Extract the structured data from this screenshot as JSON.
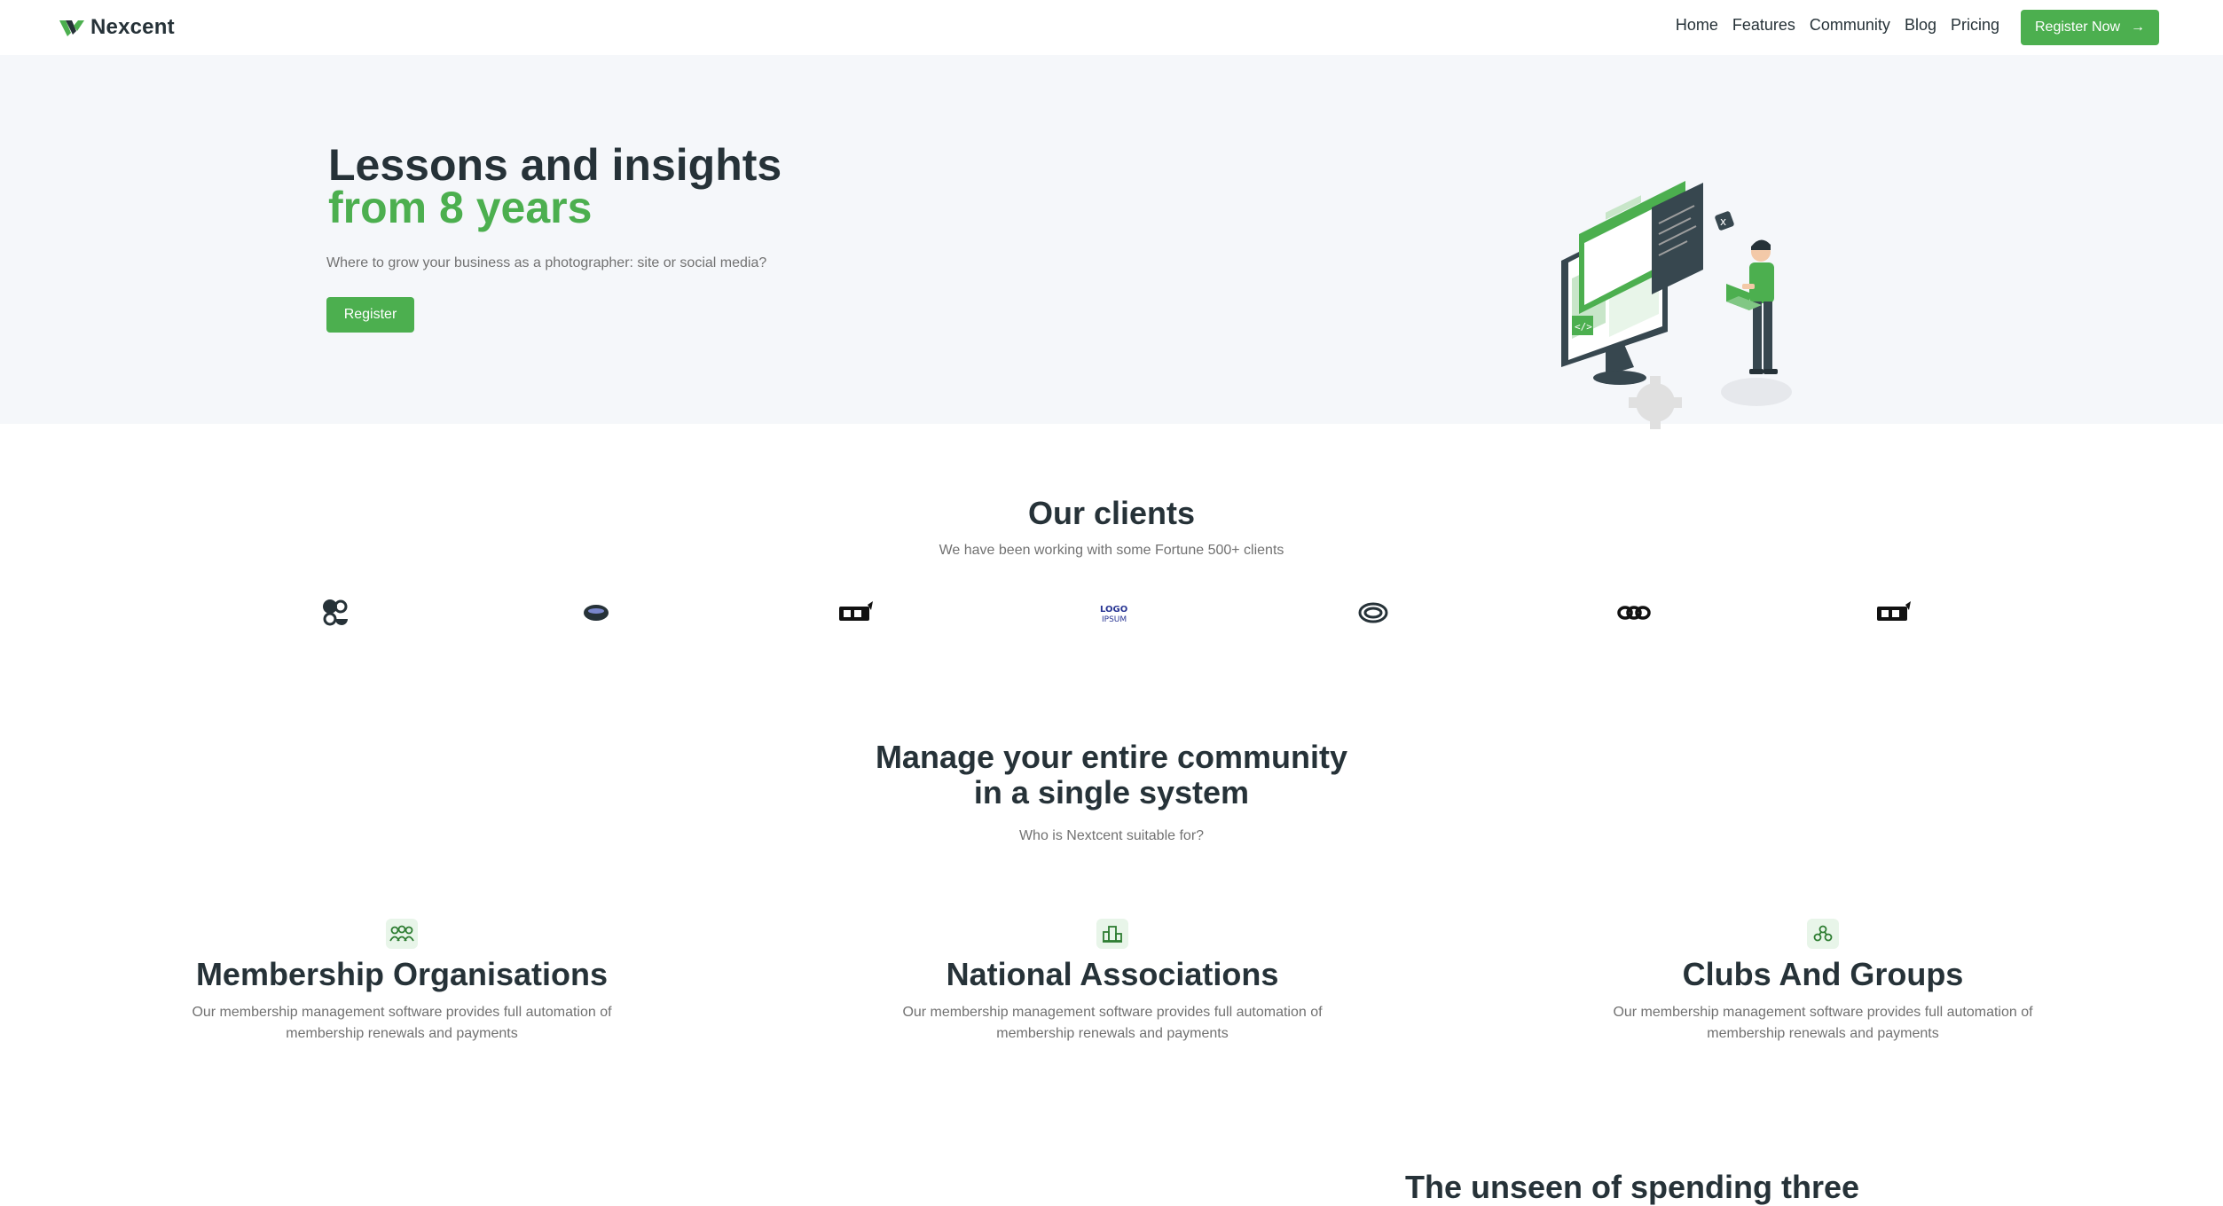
{
  "brand": {
    "name": "Nexcent"
  },
  "nav": {
    "links": [
      "Home",
      "Features",
      "Community",
      "Blog",
      "Pricing"
    ],
    "cta_label": "Register Now",
    "cta_icon": "arrow-right-icon"
  },
  "hero": {
    "title_line1": "Lessons and insights",
    "title_line2": "from 8 years",
    "subtitle": "Where to grow your business as a photographer: site or social media?",
    "button_label": "Register"
  },
  "clients": {
    "title": "Our clients",
    "subtitle": "We have been working with some Fortune 500+ clients",
    "logos": [
      "client-logo-1",
      "client-logo-2",
      "client-logo-3",
      "client-logo-4",
      "client-logo-5",
      "client-logo-6",
      "client-logo-7"
    ]
  },
  "community": {
    "title_line1": "Manage your entire community",
    "title_line2": "in a single system",
    "subtitle": "Who is Nextcent suitable for?",
    "cards": [
      {
        "icon": "members-icon",
        "title": "Membership Organisations",
        "text": "Our membership management software provides full automation of membership renewals and payments"
      },
      {
        "icon": "building-icon",
        "title": "National Associations",
        "text": "Our membership management software provides full automation of membership renewals and payments"
      },
      {
        "icon": "hand-icon",
        "title": "Clubs And Groups",
        "text": "Our membership management software provides full automation of membership renewals and payments"
      }
    ]
  },
  "next_section": {
    "title": "The unseen of spending three"
  },
  "colors": {
    "primary": "#4caf4f",
    "heading": "#263238",
    "muted": "#717171",
    "hero_bg": "#f5f7fa"
  }
}
